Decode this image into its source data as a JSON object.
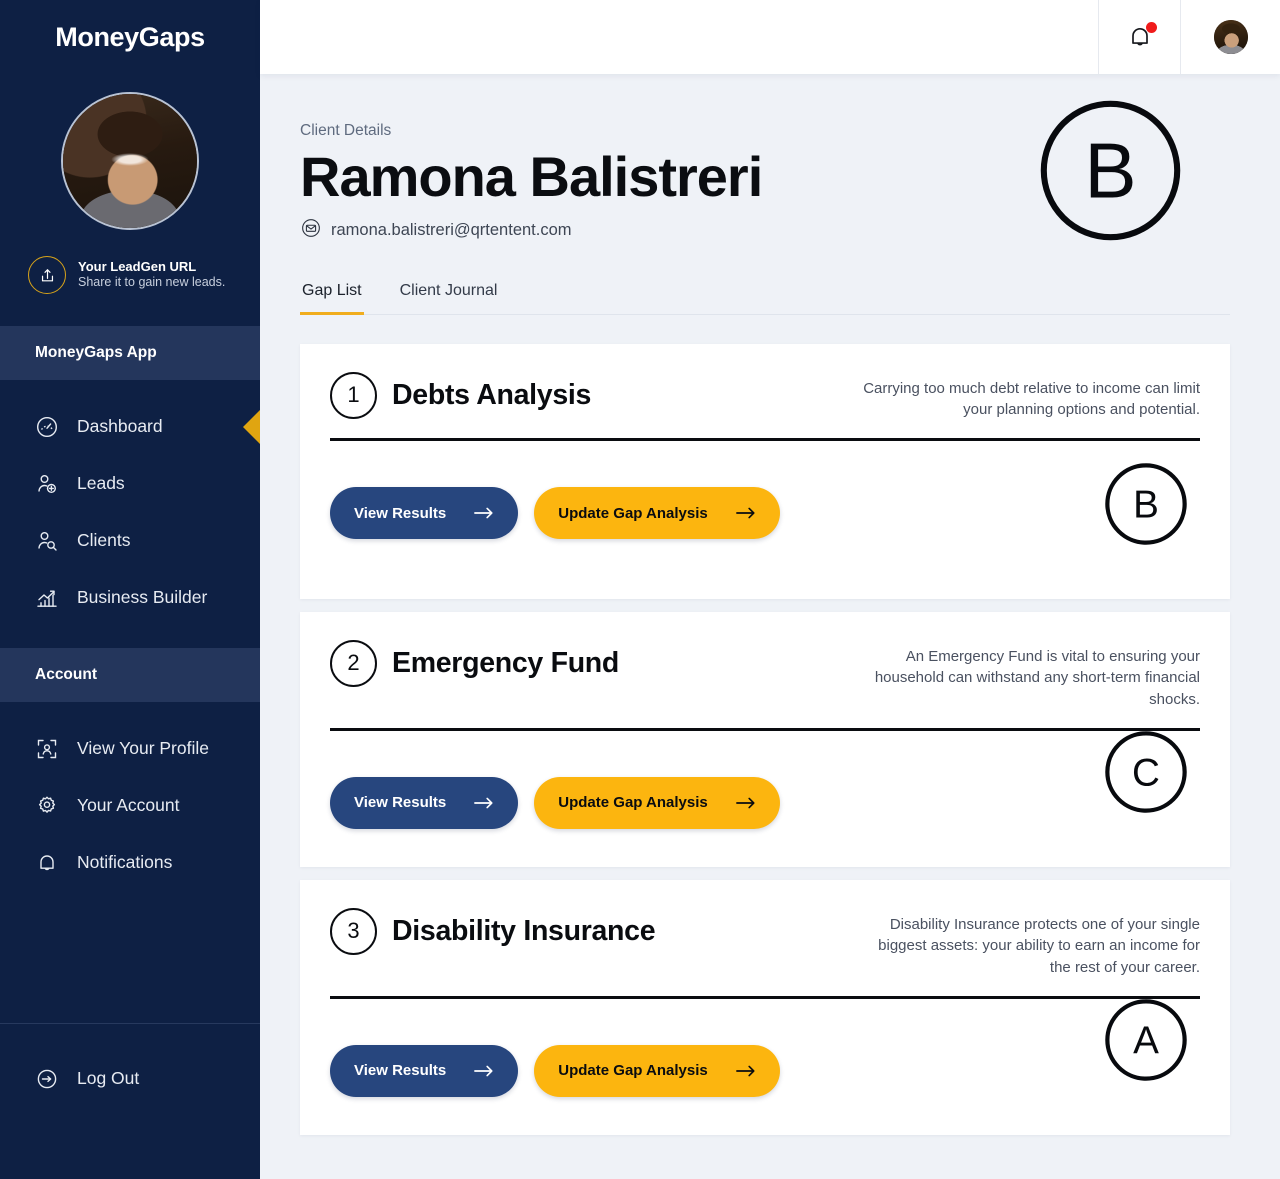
{
  "sidebar": {
    "brand": "MoneyGaps",
    "leadgen": {
      "title": "Your LeadGen URL",
      "subtitle": "Share it to gain new leads."
    },
    "app_section_label": "MoneyGaps App",
    "app_items": [
      {
        "label": "Dashboard",
        "icon": "gauge-icon",
        "active": true
      },
      {
        "label": "Leads",
        "icon": "user-plus-icon",
        "active": false
      },
      {
        "label": "Clients",
        "icon": "user-search-icon",
        "active": false
      },
      {
        "label": "Business Builder",
        "icon": "bar-chart-up-icon",
        "active": false
      }
    ],
    "account_section_label": "Account",
    "account_items": [
      {
        "label": "View Your Profile",
        "icon": "profile-frame-icon"
      },
      {
        "label": "Your Account",
        "icon": "gear-icon"
      },
      {
        "label": "Notifications",
        "icon": "bell-icon"
      }
    ],
    "logout": {
      "label": "Log Out",
      "icon": "logout-arrow-icon"
    }
  },
  "topbar": {
    "notifications_icon": "bell-icon",
    "has_unread": true,
    "avatar": "user-avatar"
  },
  "page": {
    "breadcrumb": "Client Details",
    "client_name": "Ramona Balistreri",
    "email": "ramona.balistreri@qrtentent.com",
    "email_icon": "envelope-icon",
    "overall_grade": "B"
  },
  "tabs": [
    {
      "label": "Gap List",
      "active": true
    },
    {
      "label": "Client Journal",
      "active": false
    }
  ],
  "cards": [
    {
      "number": "1",
      "title": "Debts Analysis",
      "description": "Carrying too much debt relative to income can limit your planning options and potential.",
      "grade": "B",
      "view_label": "View Results",
      "update_label": "Update Gap Analysis"
    },
    {
      "number": "2",
      "title": "Emergency Fund",
      "description": "An Emergency Fund is vital to ensuring your household can withstand any short-term financial shocks.",
      "grade": "C",
      "view_label": "View Results",
      "update_label": "Update Gap Analysis"
    },
    {
      "number": "3",
      "title": "Disability Insurance",
      "description": "Disability Insurance protects one of your single biggest assets: your ability to earn an income for the rest of your career.",
      "grade": "A",
      "view_label": "View Results",
      "update_label": "Update Gap Analysis"
    }
  ],
  "colors": {
    "sidebar_bg": "#0e2044",
    "section_bg": "#24365c",
    "accent_yellow": "#fcb50f",
    "accent_gold": "#e0a511",
    "primary_blue": "#27467e",
    "page_bg": "#eff2f7",
    "alert_red": "#f01b1b"
  }
}
